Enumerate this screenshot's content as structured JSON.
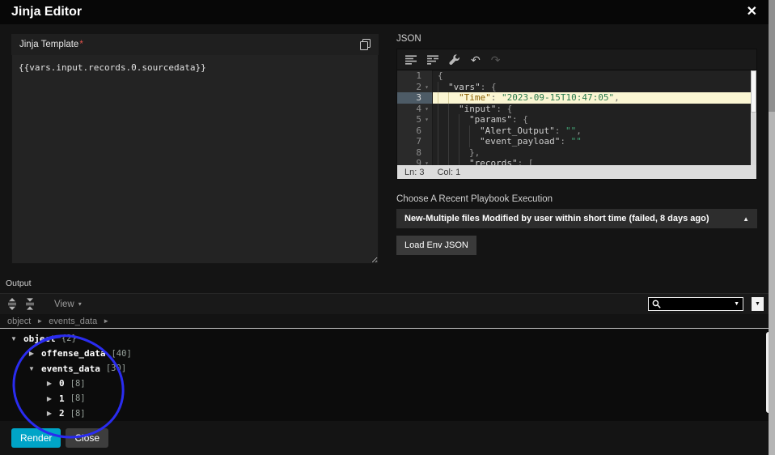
{
  "modal": {
    "title": "Jinja Editor",
    "close_glyph": "✕"
  },
  "template_panel": {
    "label": "Jinja Template",
    "required": "*",
    "value": "{{vars.input.records.0.sourcedata}}"
  },
  "json_panel": {
    "label": "JSON",
    "fold_glyph": "▾",
    "undo_glyph": "↶",
    "redo_glyph": "↷",
    "status_ln": "Ln: 3",
    "status_col": "Col: 1",
    "lines": [
      {
        "num": "1",
        "fold": false,
        "indent": 0,
        "active": false,
        "segments": [
          {
            "c": "p",
            "t": "{"
          }
        ]
      },
      {
        "num": "2",
        "fold": true,
        "indent": 1,
        "active": false,
        "segments": [
          {
            "c": "k",
            "t": "\"vars\""
          },
          {
            "c": "p",
            "t": ": {"
          }
        ]
      },
      {
        "num": "3",
        "fold": false,
        "indent": 2,
        "active": true,
        "segments": [
          {
            "c": "k",
            "t": "\"Time\""
          },
          {
            "c": "p",
            "t": ": "
          },
          {
            "c": "s",
            "t": "\"2023-09-15T10:47:05\""
          },
          {
            "c": "p",
            "t": ","
          }
        ]
      },
      {
        "num": "4",
        "fold": true,
        "indent": 2,
        "active": false,
        "segments": [
          {
            "c": "k",
            "t": "\"input\""
          },
          {
            "c": "p",
            "t": ": {"
          }
        ]
      },
      {
        "num": "5",
        "fold": true,
        "indent": 3,
        "active": false,
        "segments": [
          {
            "c": "k",
            "t": "\"params\""
          },
          {
            "c": "p",
            "t": ": {"
          }
        ]
      },
      {
        "num": "6",
        "fold": false,
        "indent": 4,
        "active": false,
        "segments": [
          {
            "c": "k",
            "t": "\"Alert_Output\""
          },
          {
            "c": "p",
            "t": ": "
          },
          {
            "c": "s",
            "t": "\"\""
          },
          {
            "c": "p",
            "t": ","
          }
        ]
      },
      {
        "num": "7",
        "fold": false,
        "indent": 4,
        "active": false,
        "segments": [
          {
            "c": "k",
            "t": "\"event_payload\""
          },
          {
            "c": "p",
            "t": ": "
          },
          {
            "c": "s",
            "t": "\"\""
          }
        ]
      },
      {
        "num": "8",
        "fold": false,
        "indent": 3,
        "active": false,
        "segments": [
          {
            "c": "p",
            "t": "},"
          }
        ]
      },
      {
        "num": "9",
        "fold": true,
        "indent": 3,
        "active": false,
        "segments": [
          {
            "c": "k",
            "t": "\"records\""
          },
          {
            "c": "p",
            "t": ": ["
          }
        ]
      }
    ]
  },
  "execution": {
    "label": "Choose A Recent Playbook Execution",
    "selected": "New-Multiple files Modified by user within short time (failed, 8 days ago)",
    "caret": "▲",
    "load_button": "Load Env JSON"
  },
  "output": {
    "label": "Output",
    "view_label": "View",
    "view_caret": "▾",
    "search_value": "",
    "search_caret": "▼",
    "search_option_caret": "▼",
    "breadcrumb": [
      "object",
      "events_data"
    ],
    "breadcrumb_sep": "►",
    "caret_expanded": "▼",
    "caret_collapsed": "▶",
    "tree": [
      {
        "caret": "▼",
        "name": "object",
        "count": "{2}",
        "level": 0
      },
      {
        "caret": "▶",
        "name": "offense_data",
        "count": "[40]",
        "level": 1
      },
      {
        "caret": "▼",
        "name": "events_data",
        "count": "[30]",
        "level": 1
      },
      {
        "caret": "▶",
        "name": "0",
        "count": "[8]",
        "level": 2
      },
      {
        "caret": "▶",
        "name": "1",
        "count": "[8]",
        "level": 2
      },
      {
        "caret": "▶",
        "name": "2",
        "count": "[8]",
        "level": 2
      }
    ]
  },
  "footer": {
    "render": "Render",
    "close": "Close"
  },
  "colors": {
    "accent": "#00a4c7",
    "annotation": "#2a2cf0",
    "active_line": "#fbf6d3"
  }
}
